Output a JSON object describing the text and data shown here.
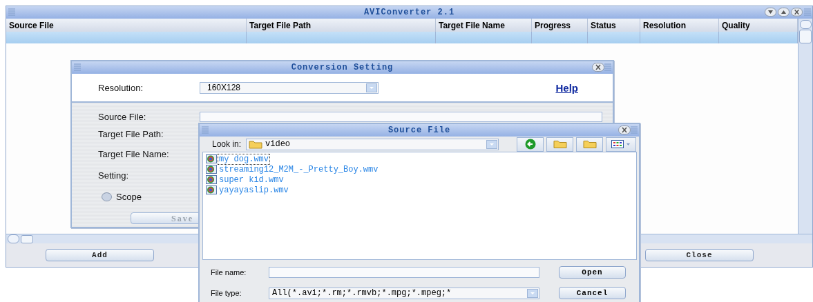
{
  "main_window": {
    "title": "AVIConverter 2.1",
    "columns": [
      "Source File",
      "Target File Path",
      "Target File Name",
      "Progress",
      "Status",
      "Resolution",
      "Quality"
    ],
    "buttons": [
      "Add",
      "Close"
    ]
  },
  "conversion_dialog": {
    "title": "Conversion Setting",
    "resolution_label": "Resolution:",
    "resolution_value": "160X128",
    "help_link": "Help",
    "fields": [
      {
        "label": "Source File:"
      },
      {
        "label": "Target File Path:"
      },
      {
        "label": "Target File Name:"
      },
      {
        "label": "Setting:"
      }
    ],
    "scope": {
      "label": "Scope",
      "checked": false
    },
    "save_button": "Save"
  },
  "source_dialog": {
    "title": "Source File",
    "look_in_label": "Look in:",
    "look_in_value": "video",
    "files": [
      {
        "name": "my dog.wmv",
        "selected": true
      },
      {
        "name": "streaming12_M2M_-_Pretty_Boy.wmv",
        "selected": false
      },
      {
        "name": "super kid.wmv",
        "selected": false
      },
      {
        "name": "yayayaslip.wmv",
        "selected": false
      }
    ],
    "file_name_label": "File name:",
    "file_type_label": "File type:",
    "file_type_value": "All(*.avi;*.rm;*.rmvb;*.mpg;*.mpeg;*",
    "buttons": [
      "Open",
      "Cancel"
    ]
  }
}
